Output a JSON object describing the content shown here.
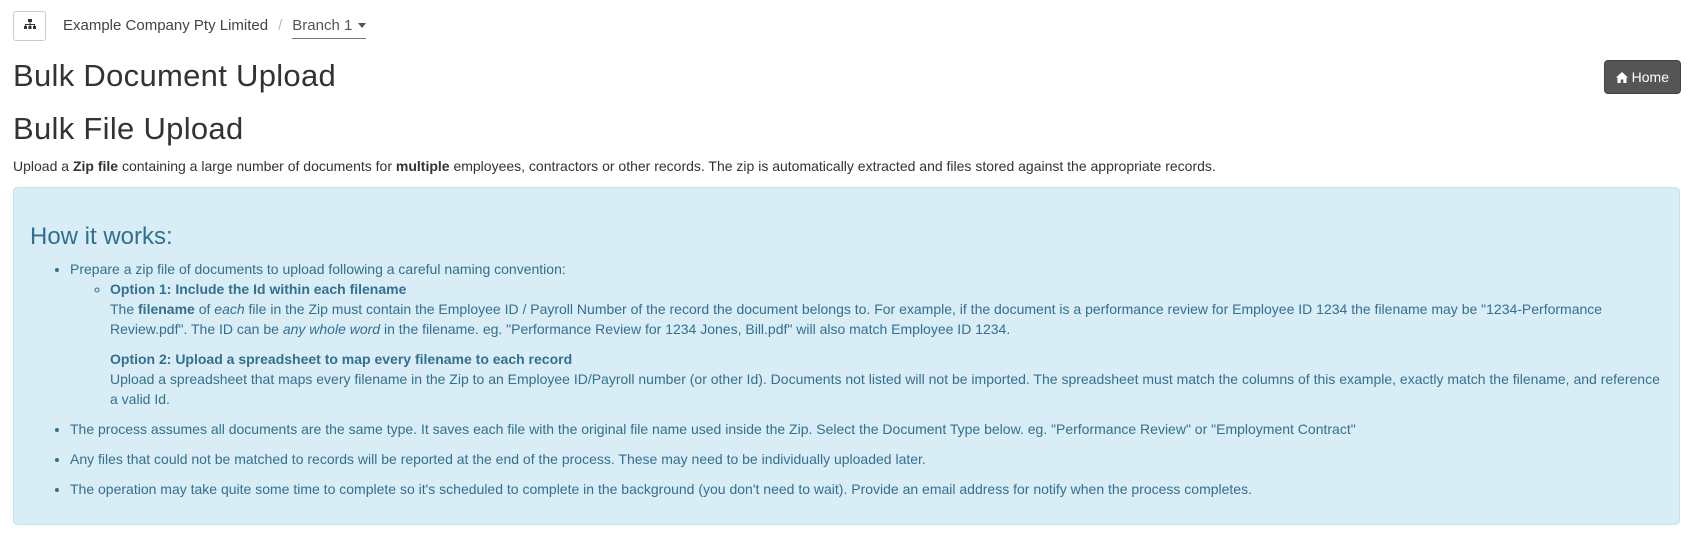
{
  "breadcrumb": {
    "company": "Example Company Pty Limited",
    "separator": "/",
    "branch": "Branch 1"
  },
  "page_title": "Bulk Document Upload",
  "home_button": {
    "label": "Home"
  },
  "section_title": "Bulk File Upload",
  "intro": {
    "t1": "Upload a ",
    "b1": "Zip file",
    "t2": " containing a large number of documents for ",
    "b2": "multiple",
    "t3": " employees, contractors or other records. The zip is automatically extracted and files stored against the appropriate records."
  },
  "how_it_works": {
    "heading": "How it works:",
    "step1": "Prepare a zip file of documents to upload following a careful naming convention:",
    "option1": {
      "title": "Option 1: Include the Id within each filename",
      "t1": "The ",
      "b1": "filename",
      "t2": " of ",
      "i1": "each",
      "t3": " file in the Zip must contain the Employee ID / Payroll Number of the record the document belongs to. For example, if the document is a performance review for Employee ID 1234 the filename may be \"1234-Performance Review.pdf\". The ID can be ",
      "i2": "any whole word",
      "t4": " in the filename. eg. \"Performance Review for 1234 Jones, Bill.pdf\" will also match Employee ID 1234."
    },
    "option2": {
      "title": "Option 2: Upload a spreadsheet to map every filename to each record",
      "body": "Upload a spreadsheet that maps every filename in the Zip to an Employee ID/Payroll number (or other Id). Documents not listed will not be imported. The spreadsheet must match the columns of this example, exactly match the filename, and reference a valid Id."
    },
    "step2": "The process assumes all documents are the same type. It saves each file with the original file name used inside the Zip. Select the Document Type below. eg. \"Performance Review\" or \"Employment Contract\"",
    "step3": "Any files that could not be matched to records will be reported at the end of the process. These may need to be individually uploaded later.",
    "step4": "The operation may take quite some time to complete so it's scheduled to complete in the background (you don't need to wait). Provide an email address for notify when the process completes."
  }
}
